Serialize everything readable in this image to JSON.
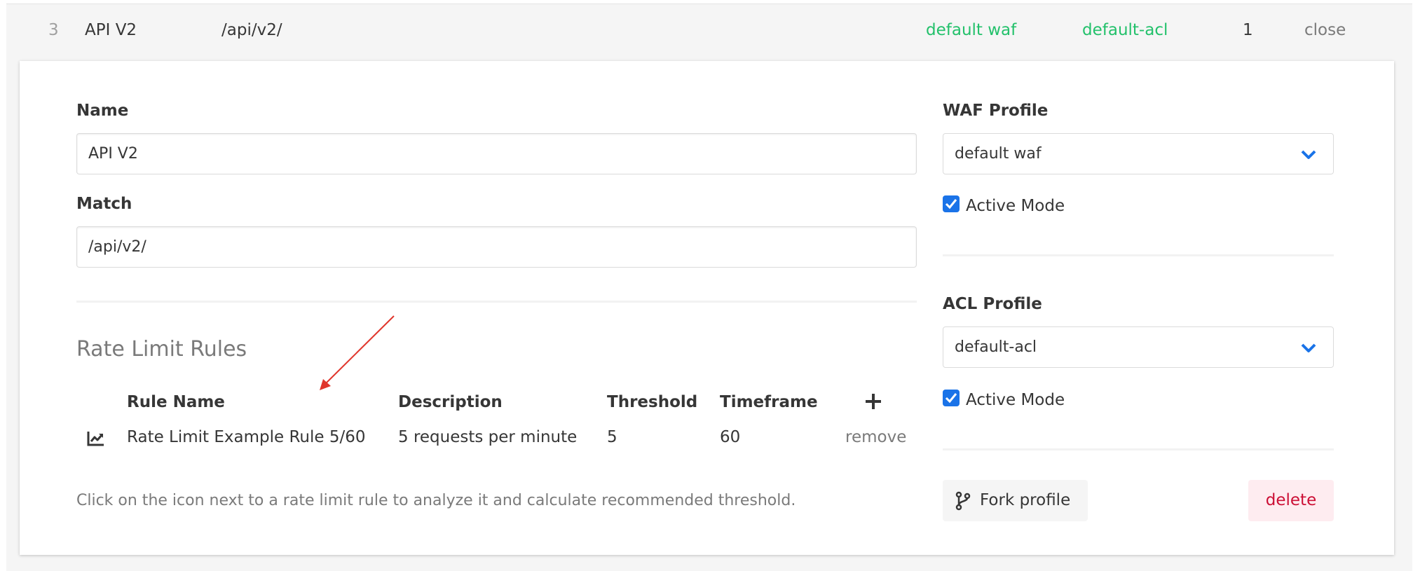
{
  "header": {
    "index": "3",
    "name": "API V2",
    "match": "/api/v2/",
    "waf": "default waf",
    "acl": "default-acl",
    "count": "1",
    "close": "close"
  },
  "form": {
    "name_label": "Name",
    "name_value": "API V2",
    "match_label": "Match",
    "match_value": "/api/v2/"
  },
  "rate_limit": {
    "title": "Rate Limit Rules",
    "columns": [
      "Rule Name",
      "Description",
      "Threshold",
      "Timeframe"
    ],
    "add_icon": "plus-icon",
    "rows": [
      {
        "icon": "chart-icon",
        "name": "Rate Limit Example Rule 5/60",
        "description": "5 requests per minute",
        "threshold": "5",
        "timeframe": "60",
        "action": "remove"
      }
    ],
    "help": "Click on the icon next to a rate limit rule to analyze it and calculate recommended threshold."
  },
  "waf": {
    "label": "WAF Profile",
    "selected": "default waf",
    "active_label": "Active Mode",
    "active": true
  },
  "acl": {
    "label": "ACL Profile",
    "selected": "default-acl",
    "active_label": "Active Mode",
    "active": true
  },
  "actions": {
    "fork": "Fork profile",
    "delete": "delete"
  },
  "colors": {
    "accent_green": "#23c16b",
    "checkbox_blue": "#1a73e8",
    "danger_red": "#cc0f35",
    "annotation_red": "#e0352b"
  }
}
